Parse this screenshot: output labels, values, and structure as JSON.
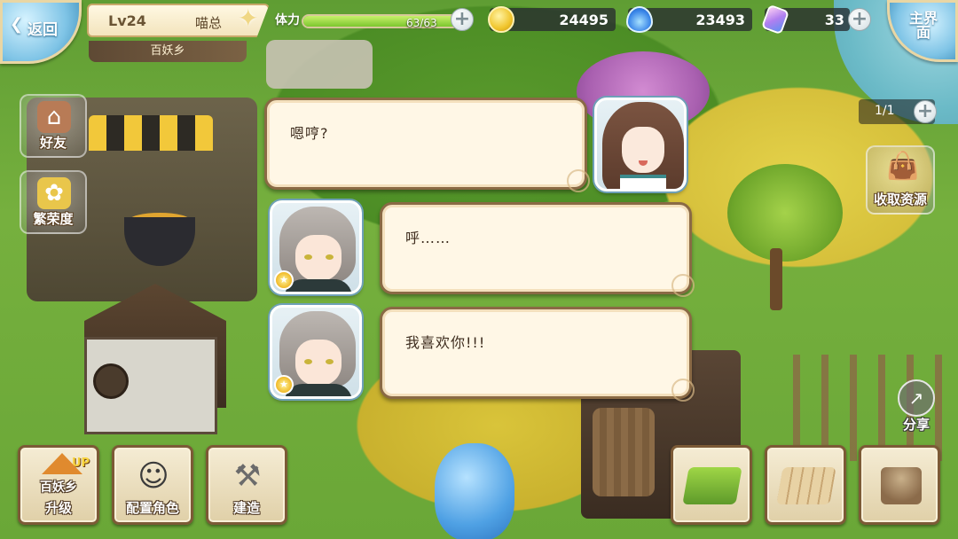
{
  "topbar": {
    "back_label": "返回",
    "level": "Lv24",
    "player_name": "喵总",
    "region": "百妖乡",
    "stamina_label": "体力",
    "stamina_value": "63/63",
    "stamina_fraction": 1.0,
    "gold": "24495",
    "spirit": "23493",
    "crystal": "33",
    "home_label": "主界面"
  },
  "left_buttons": {
    "friends": "好友",
    "prosperity": "繁荣度"
  },
  "right_panel": {
    "counter": "1/1",
    "collect": "收取资源",
    "share": "分享"
  },
  "bottom_bar": {
    "upgrade_region": "百妖乡",
    "upgrade_up": "UP",
    "upgrade_label": "升级",
    "assign_label": "配置角色",
    "build_label": "建造"
  },
  "dialogue": [
    {
      "speaker": "girl",
      "text": "嗯哼?"
    },
    {
      "speaker": "boy",
      "text": "呼……"
    },
    {
      "speaker": "boy",
      "text": "我喜欢你!!!"
    }
  ],
  "colors": {
    "bubble_bg": "#fff7e6",
    "bubble_border": "#8a6a45",
    "stamina_fill": "#7cc72f"
  },
  "icons": {
    "gold": "gold-coin-icon",
    "spirit": "blue-flame-icon",
    "crystal": "crystal-icon",
    "friends": "friends-house-icon",
    "prosperity": "prosperity-icon",
    "collect": "resource-bag-icon",
    "share": "share-icon"
  }
}
